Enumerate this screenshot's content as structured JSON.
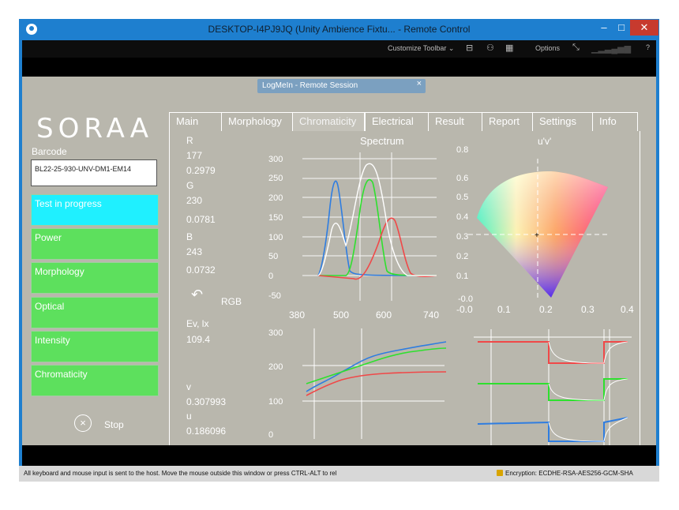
{
  "window": {
    "title": "DESKTOP-I4PJ9JQ (Unity Ambience Fixtu... - Remote Control",
    "min_icon": "minimize-icon",
    "max_icon": "maximize-icon",
    "close_icon": "close-icon",
    "min": "–",
    "max": "□",
    "close": "✕"
  },
  "toolbar": {
    "customize": "Customize Toolbar  ⌄",
    "options": "Options",
    "help": "?"
  },
  "logmein": {
    "title": "LogMeIn - Remote Session",
    "close": "×"
  },
  "brand": "SORAA",
  "barcode": {
    "label": "Barcode",
    "value": "BL22-25-930-UNV-DM1-EM14"
  },
  "statuses": [
    "Test in progress",
    "Power",
    "Morphology",
    "Optical",
    "Intensity",
    "Chromaticity"
  ],
  "stop": {
    "label": "Stop",
    "icon": "×"
  },
  "tabs": [
    "Main",
    "Morphology",
    "Chromaticity",
    "Electrical",
    "Result",
    "Report",
    "Settings",
    "Info"
  ],
  "active_tab": "Chromaticity",
  "readings": {
    "r_label": "R",
    "r_value": "177",
    "r_ratio": "0.2979",
    "g_label": "G",
    "g_value": "230",
    "g_ratio": "0.0781",
    "b_label": "B",
    "b_value": "243",
    "b_ratio": "0.0732",
    "rgb_label": "RGB",
    "rotate_icon": "rotate-icon",
    "ev_label": "Ev, lx",
    "ev_value": "109.4",
    "v_label": "v",
    "v_value": "0.307993",
    "u_label": "u",
    "u_value": "0.186096"
  },
  "charts": {
    "spectrum": {
      "title": "Spectrum",
      "y_ticks": [
        "300",
        "250",
        "200",
        "150",
        "100",
        "50",
        "0",
        "-50"
      ],
      "x_ticks": [
        "380",
        "500",
        "600",
        "740"
      ]
    },
    "cie": {
      "title": "u'v'",
      "y_ticks": [
        "0.8",
        "0.6",
        "0.5",
        "0.4",
        "0.3",
        "0.2",
        "0.1",
        "-0.0"
      ],
      "x_ticks": [
        "-0.0",
        "0.1",
        "0.2",
        "0.3",
        "0.4"
      ]
    },
    "trend": {
      "y_ticks": [
        "300",
        "200",
        "100",
        "0"
      ]
    }
  },
  "chart_data": [
    {
      "type": "line",
      "title": "Spectrum",
      "x": [
        380,
        500,
        600,
        740
      ],
      "ylim": [
        -50,
        300
      ],
      "series": [
        {
          "color": "#2f7de0",
          "peak_x": 450,
          "peak_y": 240
        },
        {
          "color": "#22e022",
          "peak_x": 545,
          "peak_y": 245
        },
        {
          "color": "#f04040",
          "peak_x": 610,
          "peak_y": 150
        },
        {
          "color": "#ffffff",
          "peak_x": 555,
          "peak_y": 270
        }
      ]
    },
    {
      "type": "scatter",
      "title": "u'v'",
      "xlim": [
        0,
        0.4
      ],
      "ylim": [
        0,
        0.8
      ],
      "point": {
        "x": 0.186,
        "y": 0.308
      }
    },
    {
      "type": "line",
      "ylim": [
        0,
        300
      ]
    }
  ],
  "status_bar": {
    "left": "All keyboard and mouse input is sent to the host. Move the mouse outside this window or press CTRL-ALT to rel",
    "right": "Encryption: ECDHE-RSA-AES256-GCM-SHA"
  }
}
